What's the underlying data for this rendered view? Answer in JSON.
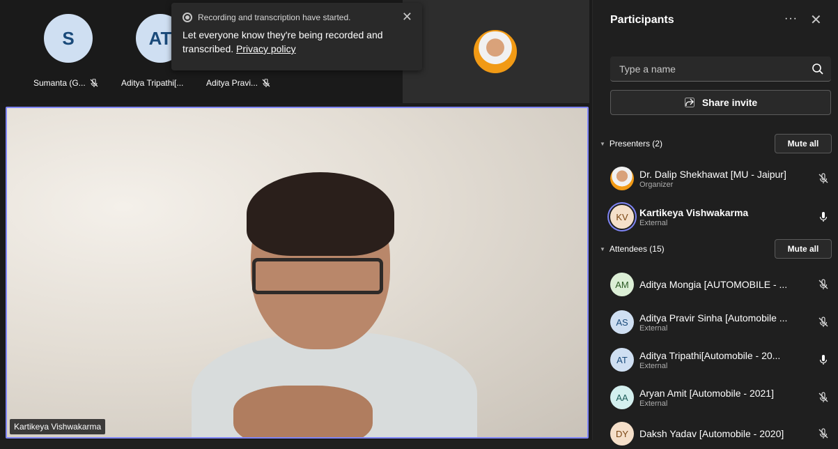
{
  "gallery": {
    "tiles": [
      {
        "initials": "S",
        "name": "Sumanta (G..."
      },
      {
        "initials": "AT",
        "name": "Aditya Tripathi[..."
      },
      {
        "initials": "",
        "name": "Aditya Pravi..."
      }
    ]
  },
  "toast": {
    "status": "Recording and transcription have started.",
    "message": "Let everyone know they're being recorded and transcribed.",
    "link": "Privacy policy",
    "close_icon": "close-icon"
  },
  "main_video": {
    "speaker_name": "Kartikeya Vishwakarma"
  },
  "panel": {
    "title": "Participants",
    "more_label": "···",
    "close_label": "✕",
    "search_placeholder": "Type a name",
    "share_label": "Share invite",
    "presenters_label": "Presenters (2)",
    "attendees_label": "Attendees (15)",
    "mute_all_label": "Mute all",
    "presenters": [
      {
        "initials": "",
        "name": "Dr. Dalip Shekhawat [MU - Jaipur]",
        "role": "Organizer",
        "mic": "mic-off-icon"
      },
      {
        "initials": "KV",
        "name": "Kartikeya Vishwakarma",
        "role": "External",
        "mic": "mic-on-icon"
      }
    ],
    "attendees": [
      {
        "initials": "AM",
        "name": "Aditya Mongia [AUTOMOBILE - ...",
        "role": "",
        "mic": "mic-off-icon",
        "color": "#dcefd6",
        "text": "#2b5a24"
      },
      {
        "initials": "AS",
        "name": "Aditya Pravir Sinha [Automobile ...",
        "role": "External",
        "mic": "mic-off-icon",
        "color": "#cfdff2",
        "text": "#1a4a7a"
      },
      {
        "initials": "AT",
        "name": "Aditya Tripathi[Automobile - 20...",
        "role": "External",
        "mic": "mic-on-icon",
        "color": "#cfdff2",
        "text": "#1a4a7a"
      },
      {
        "initials": "AA",
        "name": "Aryan Amit [Automobile - 2021]",
        "role": "External",
        "mic": "mic-off-icon",
        "color": "#d3efee",
        "text": "#1c5b58"
      },
      {
        "initials": "DY",
        "name": "Daksh Yadav [Automobile - 2020]",
        "role": "",
        "mic": "mic-off-icon",
        "color": "#f5dfc9",
        "text": "#7a4512"
      }
    ]
  },
  "colors": {
    "accent": "#7f85f5",
    "organizer_ring": "#f19a15"
  }
}
